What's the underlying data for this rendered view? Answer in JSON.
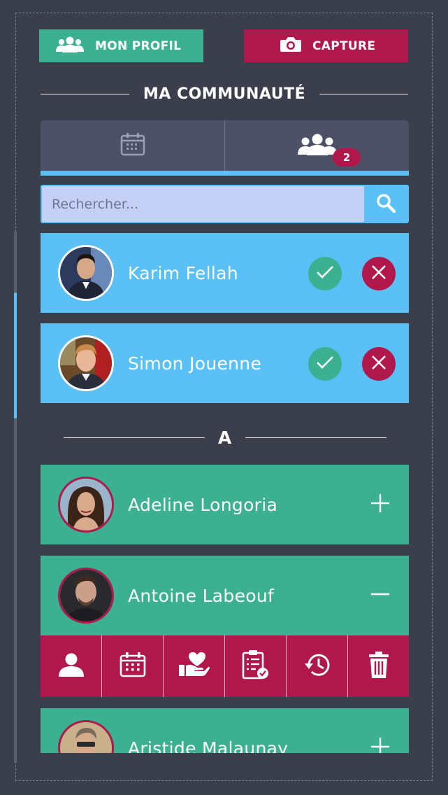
{
  "header": {
    "profile_label": "MON PROFIL",
    "capture_label": "CAPTURE"
  },
  "section_title": "MA COMMUNAUTÉ",
  "tabs": {
    "calendar_icon": "calendar-icon",
    "community_icon": "group-icon",
    "community_badge": "2"
  },
  "search": {
    "placeholder": "Rechercher...",
    "value": ""
  },
  "requests": [
    {
      "name": "Karim Fellah"
    },
    {
      "name": "Simon Jouenne"
    }
  ],
  "group_letter": "A",
  "contacts": [
    {
      "name": "Adeline Longoria",
      "expanded": false
    },
    {
      "name": "Antoine Labeouf",
      "expanded": true
    },
    {
      "name": "Aristide Malaunay",
      "expanded": false
    }
  ],
  "contact_actions": [
    "profile-icon",
    "calendar-icon",
    "donate-icon",
    "checklist-icon",
    "history-icon",
    "trash-icon"
  ],
  "colors": {
    "background": "#3a3f4b",
    "green": "#3cb192",
    "crimson": "#b0174a",
    "blue": "#5bc0f5",
    "tab_bg": "#4d5167",
    "search_bg": "#c5d0f6"
  }
}
